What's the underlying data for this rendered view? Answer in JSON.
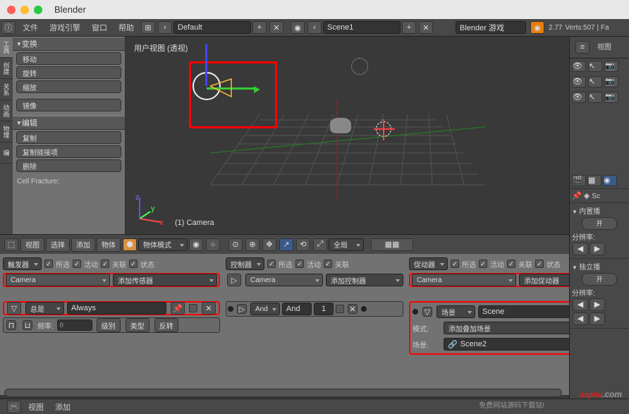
{
  "titlebar": {
    "app": "Blender"
  },
  "topmenu": {
    "file": "文件",
    "engine": "游戏引擎",
    "window": "窗口",
    "help": "帮助",
    "layout": "Default",
    "scene": "Scene1",
    "renderer": "Blender 游戏",
    "version": "2.77",
    "stats": "Verts:507 | Fa"
  },
  "left": {
    "transform": "变换",
    "move": "移动",
    "rotate": "旋转",
    "scale": "缩放",
    "mirror": "镜像",
    "edit": "编辑",
    "dup": "复制",
    "duplink": "复制链接项",
    "del": "删除",
    "cell": "Cell Fracture:"
  },
  "tabs": {
    "t1": "工具",
    "t2": "创建",
    "t3": "关系",
    "t4": "动画",
    "t5": "物理",
    "t6": "编"
  },
  "vp": {
    "header": "用户视图 (透视)",
    "label": "(1) Camera",
    "x": "x",
    "y": "y",
    "z": "z"
  },
  "vbar": {
    "view": "视图",
    "select": "选择",
    "add": "添加",
    "object": "物体",
    "mode": "物体模式",
    "global": "全局"
  },
  "logic": {
    "sel": "所选",
    "active": "活动",
    "link": "关联",
    "state": "状态",
    "sensor": "触发器",
    "controller": "控制器",
    "actuator": "促动器",
    "cam": "Camera",
    "addS": "添加传感器",
    "addC": "添加控制器",
    "addA": "添加促动器",
    "always": "总是",
    "alwaysEn": "Always",
    "and": "And",
    "andLbl": "And",
    "one": "1",
    "scene": "场景",
    "sceneEn": "Scene",
    "mode": "模式:",
    "addoverlay": "添加叠加场景",
    "scenelbl": "场景:",
    "scene2": "Scene2",
    "freq": "频率:",
    "zero": "0",
    "level": "级别",
    "type": "类型",
    "invert": "反转"
  },
  "right": {
    "view": "视图",
    "builtin": "内置播",
    "on": "开",
    "res": "分辨率:",
    "solo": "独立播",
    "sc": "Sc"
  },
  "bottom": {
    "view": "视图",
    "add": "添加"
  },
  "wm": {
    "text": "免费网站源码下载站!",
    "logo": "aspku",
    "dom": ".com"
  }
}
